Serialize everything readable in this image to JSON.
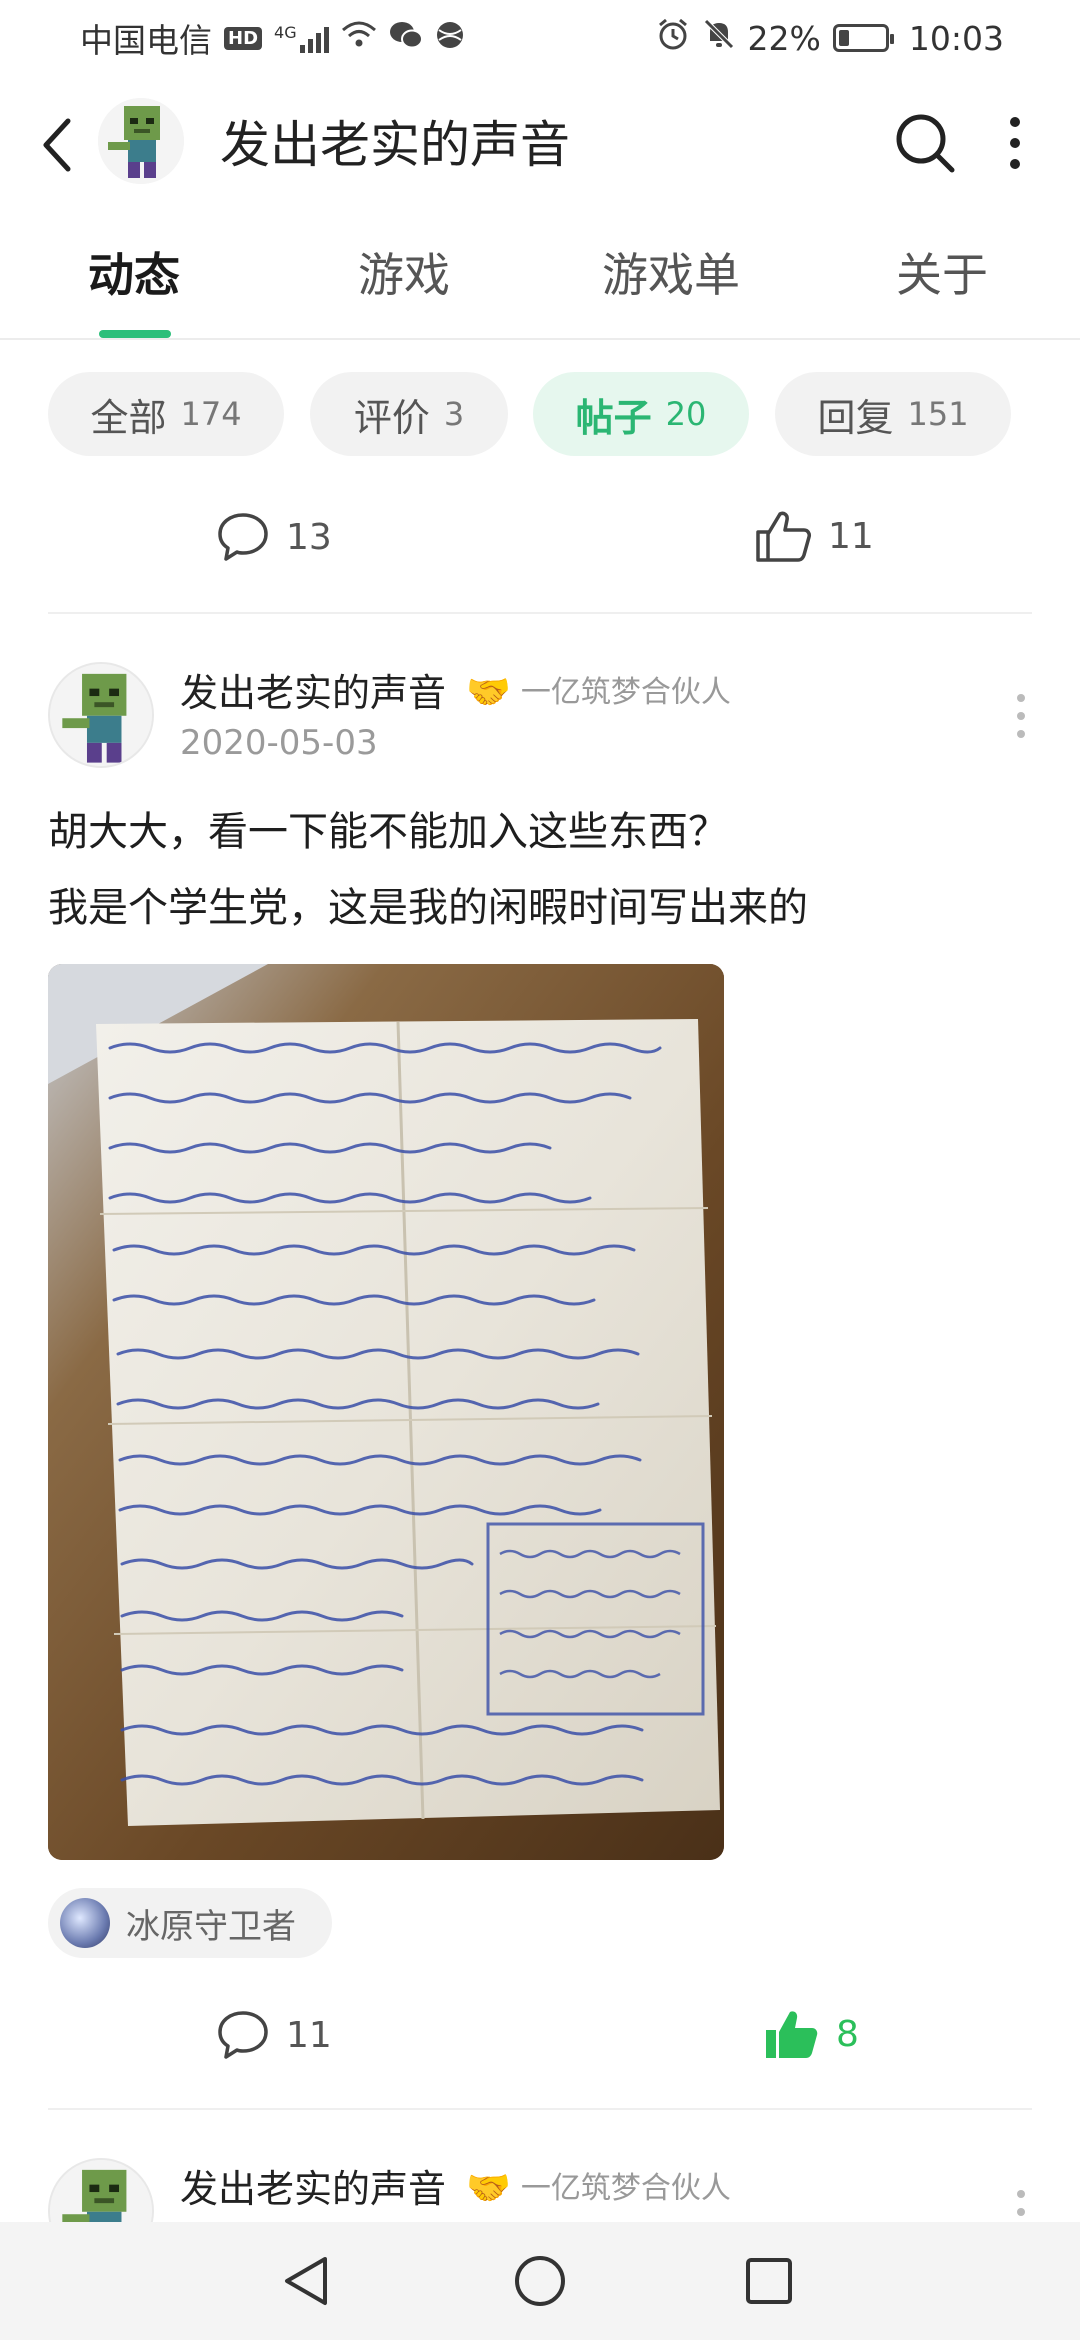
{
  "status_bar": {
    "carrier": "中国电信",
    "hd": "HD",
    "signal_label": "4G",
    "battery_percent": "22%",
    "battery_level": 0.22,
    "time": "10:03"
  },
  "header": {
    "title": "发出老实的声音"
  },
  "tabs": [
    {
      "label": "动态",
      "active": true
    },
    {
      "label": "游戏",
      "active": false
    },
    {
      "label": "游戏单",
      "active": false
    },
    {
      "label": "关于",
      "active": false
    }
  ],
  "filters": [
    {
      "label": "全部",
      "count": "174",
      "active": false
    },
    {
      "label": "评价",
      "count": "3",
      "active": false
    },
    {
      "label": "帖子",
      "count": "20",
      "active": true
    },
    {
      "label": "回复",
      "count": "151",
      "active": false
    }
  ],
  "prev_post_stats": {
    "comments": "13",
    "likes": "11"
  },
  "post": {
    "author": "发出老实的声音",
    "badge": "一亿筑梦合伙人",
    "date": "2020-05-03",
    "line1": "胡大大，看一下能不能加入这些东西？",
    "line2": "我是个学生党，这是我的闲暇时间写出来的",
    "tag": "冰原守卫者",
    "comments": "11",
    "likes": "8"
  },
  "next_post": {
    "author": "发出老实的声音",
    "badge": "一亿筑梦合伙人"
  },
  "colors": {
    "accent": "#2bbf7a",
    "like_active": "#2bbf5a"
  }
}
